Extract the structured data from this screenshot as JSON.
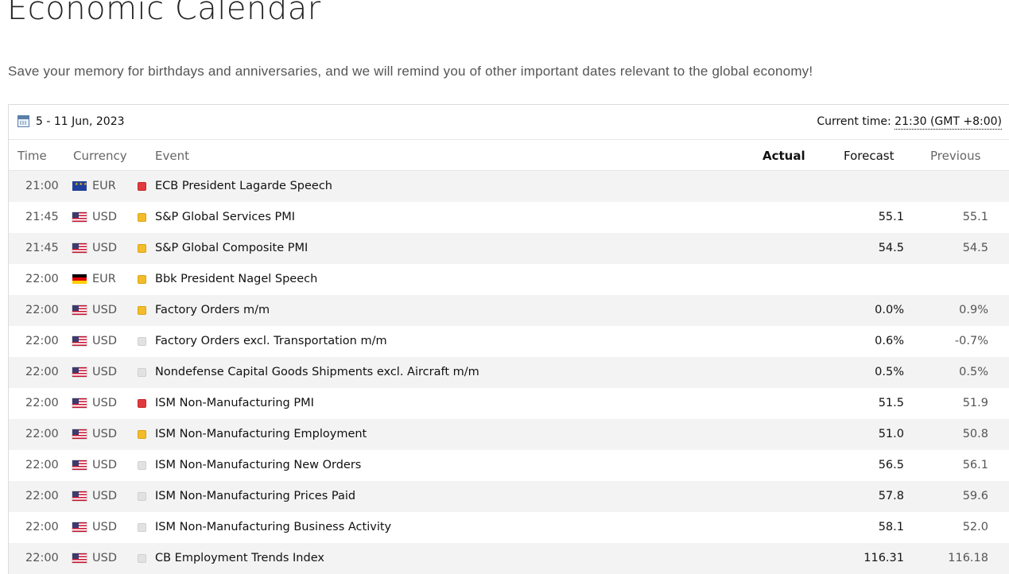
{
  "page": {
    "title": "Economic Calendar",
    "subtitle": "Save your memory for birthdays and anniversaries, and we will remind you of other important dates relevant to the global economy!"
  },
  "calendar": {
    "week_range": "5 - 11 Jun, 2023",
    "current_time_label": "Current time:",
    "current_time_value": "21:30 (GMT +8:00)",
    "icon": "calendar-icon",
    "columns": {
      "time": "Time",
      "currency": "Currency",
      "event": "Event",
      "actual": "Actual",
      "forecast": "Forecast",
      "previous": "Previous"
    },
    "importance_colors": {
      "high": "#e0393e",
      "medium": "#f2bc2b",
      "low": "#e2e2e2"
    },
    "rows": [
      {
        "time": "21:00",
        "flag": "eu-flag-icon",
        "currency": "EUR",
        "importance": "high",
        "event": "ECB President Lagarde Speech",
        "actual": "",
        "forecast": "",
        "previous": ""
      },
      {
        "time": "21:45",
        "flag": "us-flag-icon",
        "currency": "USD",
        "importance": "medium",
        "event": "S&P Global Services PMI",
        "actual": "",
        "forecast": "55.1",
        "previous": "55.1"
      },
      {
        "time": "21:45",
        "flag": "us-flag-icon",
        "currency": "USD",
        "importance": "medium",
        "event": "S&P Global Composite PMI",
        "actual": "",
        "forecast": "54.5",
        "previous": "54.5"
      },
      {
        "time": "22:00",
        "flag": "de-flag-icon",
        "currency": "EUR",
        "importance": "medium",
        "event": "Bbk President Nagel Speech",
        "actual": "",
        "forecast": "",
        "previous": ""
      },
      {
        "time": "22:00",
        "flag": "us-flag-icon",
        "currency": "USD",
        "importance": "medium",
        "event": "Factory Orders m/m",
        "actual": "",
        "forecast": "0.0%",
        "previous": "0.9%"
      },
      {
        "time": "22:00",
        "flag": "us-flag-icon",
        "currency": "USD",
        "importance": "low",
        "event": "Factory Orders excl. Transportation m/m",
        "actual": "",
        "forecast": "0.6%",
        "previous": "-0.7%"
      },
      {
        "time": "22:00",
        "flag": "us-flag-icon",
        "currency": "USD",
        "importance": "low",
        "event": "Nondefense Capital Goods Shipments excl. Aircraft m/m",
        "actual": "",
        "forecast": "0.5%",
        "previous": "0.5%"
      },
      {
        "time": "22:00",
        "flag": "us-flag-icon",
        "currency": "USD",
        "importance": "high",
        "event": "ISM Non-Manufacturing PMI",
        "actual": "",
        "forecast": "51.5",
        "previous": "51.9"
      },
      {
        "time": "22:00",
        "flag": "us-flag-icon",
        "currency": "USD",
        "importance": "medium",
        "event": "ISM Non-Manufacturing Employment",
        "actual": "",
        "forecast": "51.0",
        "previous": "50.8"
      },
      {
        "time": "22:00",
        "flag": "us-flag-icon",
        "currency": "USD",
        "importance": "low",
        "event": "ISM Non-Manufacturing New Orders",
        "actual": "",
        "forecast": "56.5",
        "previous": "56.1"
      },
      {
        "time": "22:00",
        "flag": "us-flag-icon",
        "currency": "USD",
        "importance": "low",
        "event": "ISM Non-Manufacturing Prices Paid",
        "actual": "",
        "forecast": "57.8",
        "previous": "59.6"
      },
      {
        "time": "22:00",
        "flag": "us-flag-icon",
        "currency": "USD",
        "importance": "low",
        "event": "ISM Non-Manufacturing Business Activity",
        "actual": "",
        "forecast": "58.1",
        "previous": "52.0"
      },
      {
        "time": "22:00",
        "flag": "us-flag-icon",
        "currency": "USD",
        "importance": "low",
        "event": "CB Employment Trends Index",
        "actual": "",
        "forecast": "116.31",
        "previous": "116.18"
      }
    ]
  }
}
